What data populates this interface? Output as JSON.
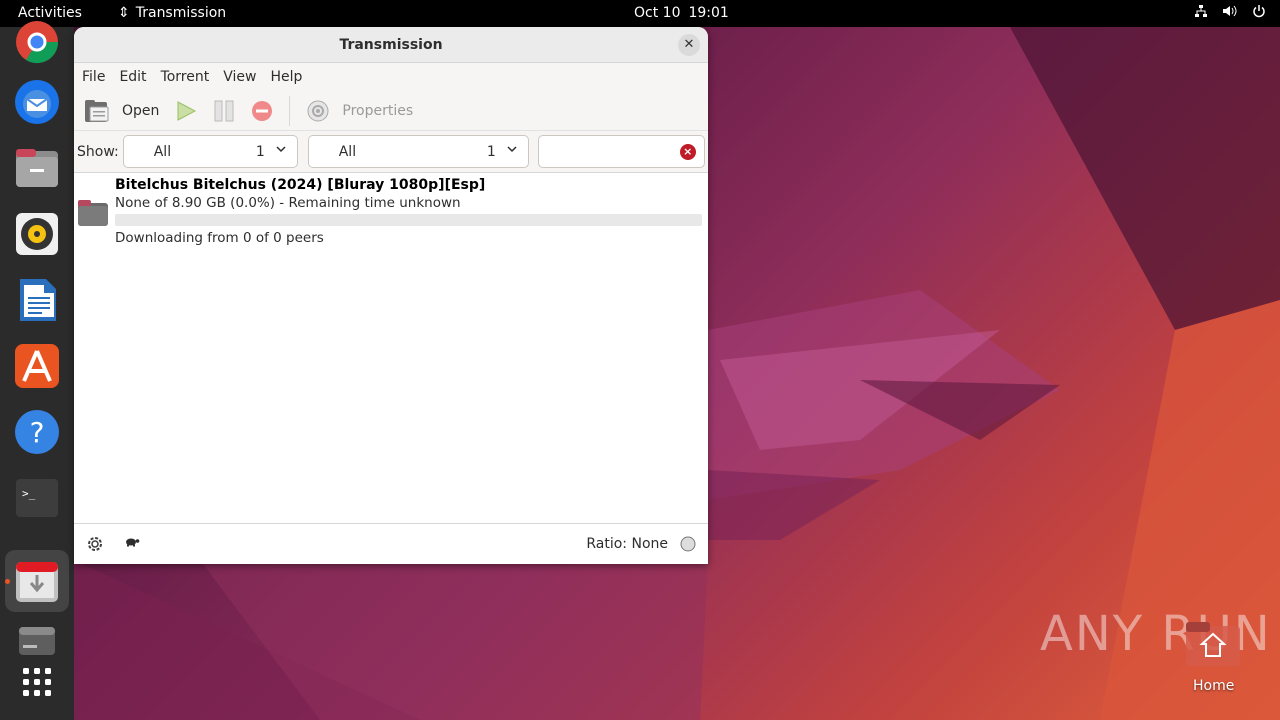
{
  "topbar": {
    "activities": "Activities",
    "app_name": "Transmission",
    "date": "Oct 10",
    "time": "19:01",
    "tray_icons": [
      "network-icon",
      "volume-icon",
      "power-icon"
    ]
  },
  "dock": {
    "items": [
      "chrome-icon",
      "thunderbird-icon",
      "files-icon",
      "rhythmbox-icon",
      "libreoffice-writer-icon",
      "app-center-icon",
      "help-icon",
      "terminal-icon",
      "transmission-icon",
      "drive-icon",
      "show-apps-icon"
    ],
    "active": "transmission-icon",
    "accent": "#e95420"
  },
  "window": {
    "title": "Transmission",
    "menu": [
      "File",
      "Edit",
      "Torrent",
      "View",
      "Help"
    ],
    "toolbar": {
      "open_label": "Open",
      "properties_label": "Properties"
    },
    "filter": {
      "show_label": "Show:",
      "activity_value": "All",
      "activity_count": "1",
      "tracker_value": "All",
      "tracker_count": "1",
      "search_value": ""
    },
    "torrents": [
      {
        "name": "Bitelchus Bitelchus (2024) [Bluray 1080p][Esp]",
        "progress_text": "None of 8.90 GB (0.0%) - Remaining time unknown",
        "progress": 0.0,
        "status": "Downloading from 0 of 0 peers"
      }
    ],
    "statusbar": {
      "ratio_text": "Ratio: None"
    }
  },
  "desktop": {
    "watermark": "ANY RUN",
    "home_label": "Home"
  }
}
